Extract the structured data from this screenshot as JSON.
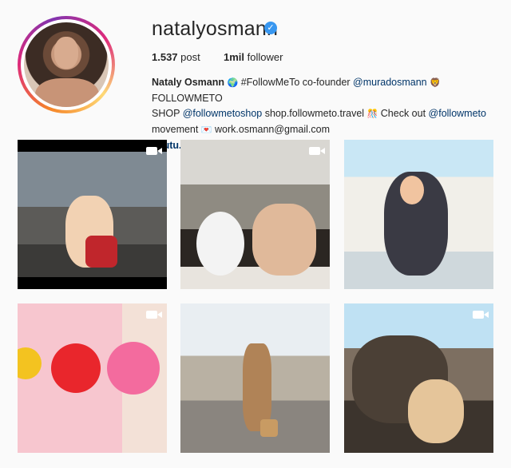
{
  "profile": {
    "username": "natalyosmann",
    "verified": true,
    "stats": {
      "posts": {
        "value": "1.537",
        "label": "post"
      },
      "followers": {
        "value": "1mil",
        "label": "follower"
      }
    },
    "bio": {
      "display_name": "Nataly Osmann",
      "line1_text1": "#FollowMeTo co-founder",
      "mention1": "@muradosmann",
      "line1_text2": "FOLLOWMETO",
      "line2_text1": "SHOP",
      "mention2": "@followmetoshop",
      "line2_text2": "shop.followmeto.travel",
      "line2_text3": "Check out",
      "mention3": "@followmeto",
      "line3_text1": "movement",
      "email": "work.osmann@gmail.com",
      "link": "youtu.be/jemjmCmHBjg"
    }
  },
  "grid": {
    "posts": [
      {
        "kind": "video",
        "icon": "video-camera-icon"
      },
      {
        "kind": "video",
        "icon": "video-camera-icon"
      },
      {
        "kind": "image"
      },
      {
        "kind": "video",
        "icon": "video-camera-icon"
      },
      {
        "kind": "image"
      },
      {
        "kind": "video",
        "icon": "video-camera-icon"
      }
    ]
  },
  "colors": {
    "verified_blue": "#3897f0",
    "link_blue": "#003569",
    "ring_gradient": [
      "#f58529",
      "#dd2a7b",
      "#8134af",
      "#feda77"
    ]
  }
}
